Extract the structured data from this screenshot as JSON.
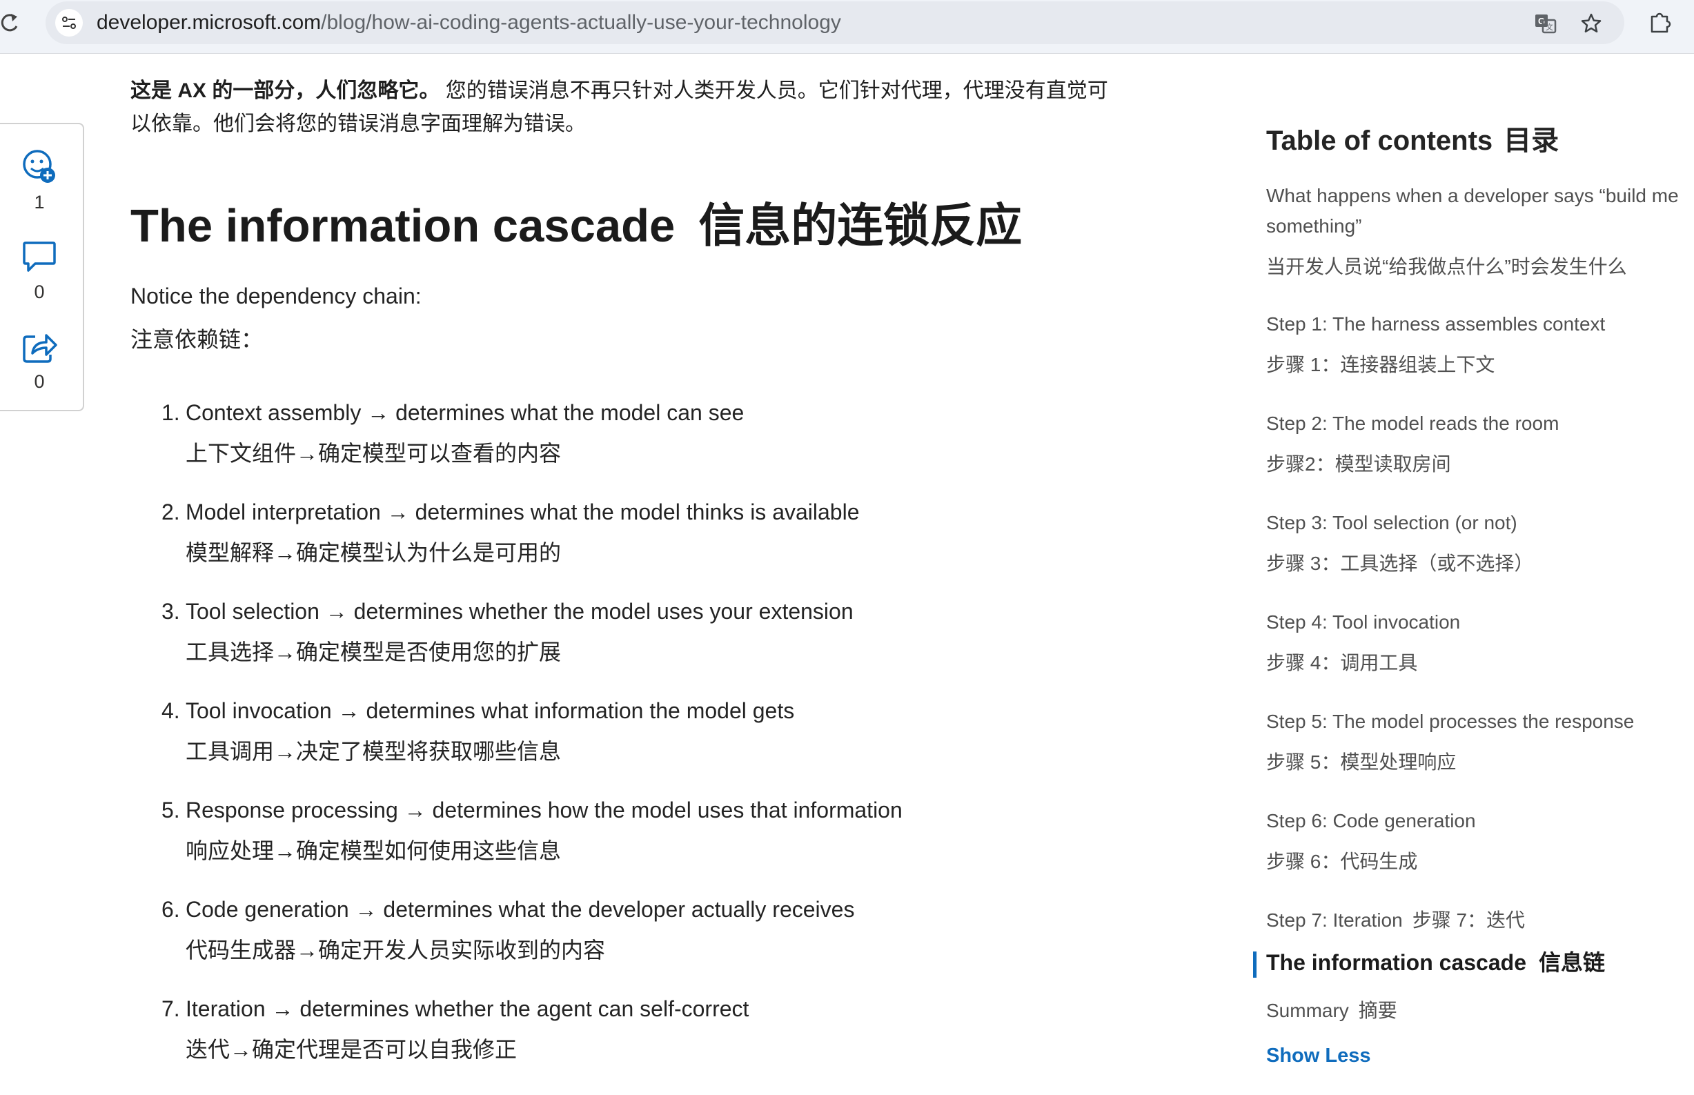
{
  "browser": {
    "url_host": "developer.microsoft.com",
    "url_path": "/blog/how-ai-coding-agents-actually-use-your-technology"
  },
  "share_rail": {
    "reactions_count": "1",
    "comments_count": "0",
    "shares_count": "0"
  },
  "article": {
    "intro_bold": "这是 AX 的一部分，人们忽略它。",
    "intro_rest": " 您的错误消息不再只针对人类开发人员。它们针对代理，代理没有直觉可以依靠。他们会将您的错误消息字面理解为错误。",
    "heading_en": "The information cascade",
    "heading_zh": "信息的连锁反应",
    "notice_en": "Notice the dependency chain:",
    "notice_zh": "注意依赖链：",
    "steps": [
      {
        "num": "1.",
        "en": "Context assembly → determines what the model can see",
        "zh": "上下文组件→确定模型可以查看的内容"
      },
      {
        "num": "2.",
        "en": "Model interpretation → determines what the model thinks is available",
        "zh": "模型解释→确定模型认为什么是可用的"
      },
      {
        "num": "3.",
        "en": "Tool selection → determines whether the model uses your extension",
        "zh": "工具选择→确定模型是否使用您的扩展"
      },
      {
        "num": "4.",
        "en": "Tool invocation → determines what information the model gets",
        "zh": "工具调用→决定了模型将获取哪些信息"
      },
      {
        "num": "5.",
        "en": "Response processing → determines how the model uses that information",
        "zh": "响应处理→确定模型如何使用这些信息"
      },
      {
        "num": "6.",
        "en": "Code generation → determines what the developer actually receives",
        "zh": "代码生成器→确定开发人员实际收到的内容"
      },
      {
        "num": "7.",
        "en": "Iteration → determines whether the agent can self-correct",
        "zh": "迭代→确定代理是否可以自我修正"
      }
    ]
  },
  "toc": {
    "title_en": "Table of contents",
    "title_zh": "目录",
    "items": [
      {
        "en": "What happens when a developer says “build me something”",
        "zh": "当开发人员说“给我做点什么”时会发生什么"
      },
      {
        "en": "Step 1: The harness assembles context",
        "zh": "步骤 1：连接器组装上下文"
      },
      {
        "en": "Step 2: The model reads the room",
        "zh": "步骤2：模型读取房间"
      },
      {
        "en": "Step 3: Tool selection (or not)",
        "zh": "步骤 3：工具选择（或不选择）"
      },
      {
        "en": "Step 4: Tool invocation",
        "zh": "步骤 4：调用工具"
      },
      {
        "en": "Step 5: The model processes the response",
        "zh": "步骤 5：模型处理响应"
      },
      {
        "en": "Step 6: Code generation",
        "zh": "步骤 6：代码生成"
      },
      {
        "en": "Step 7: Iteration",
        "zh": "步骤 7：迭代"
      }
    ],
    "active_en": "The information cascade",
    "active_zh": "信息链",
    "summary_en": "Summary",
    "summary_zh": "摘要",
    "show_less": "Show Less"
  },
  "colors": {
    "accent": "#0f6cbd",
    "text": "#242424",
    "muted": "#505050"
  }
}
